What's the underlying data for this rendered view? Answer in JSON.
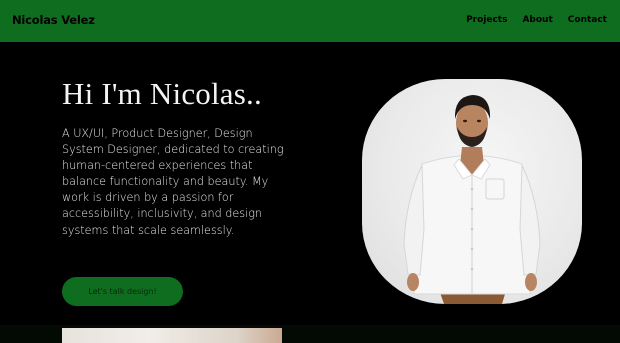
{
  "brand": {
    "name": "Nicolas Velez"
  },
  "nav": {
    "links": [
      {
        "label": "Projects"
      },
      {
        "label": "About"
      },
      {
        "label": "Contact"
      }
    ]
  },
  "hero": {
    "title": "Hi I'm Nicolas..",
    "description": "A UX/UI, Product Designer, Design System Designer, dedicated to creating human-centered experiences that balance functionality and beauty. My work is driven by a passion for accessibility, inclusivity, and design systems that scale seamlessly.",
    "cta_label": "Let's talk design!"
  },
  "colors": {
    "nav_background": "#0f6d1f",
    "page_background": "#000000",
    "text_dark": "#000000",
    "text_light": "#f4f4f4"
  }
}
